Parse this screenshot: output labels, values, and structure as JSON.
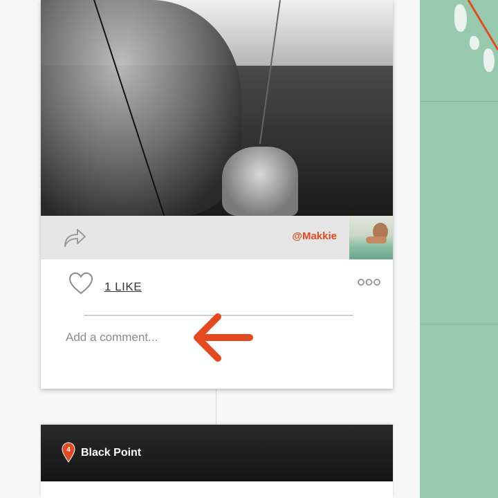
{
  "post": {
    "handle": "@Makkie",
    "likes_label": "1 LIKE",
    "comment_placeholder": "Add a comment..."
  },
  "next_post": {
    "pin_number": "4",
    "location": "Black Point"
  },
  "icons": {
    "share": "share-arrow-icon",
    "like": "heart-icon",
    "more": "more-options-icon",
    "annotation": "red-arrow-icon",
    "pin": "map-pin-icon"
  },
  "colors": {
    "accent": "#e44a1f",
    "map": "#96c9ad",
    "share_bar": "#e6e6e6"
  }
}
